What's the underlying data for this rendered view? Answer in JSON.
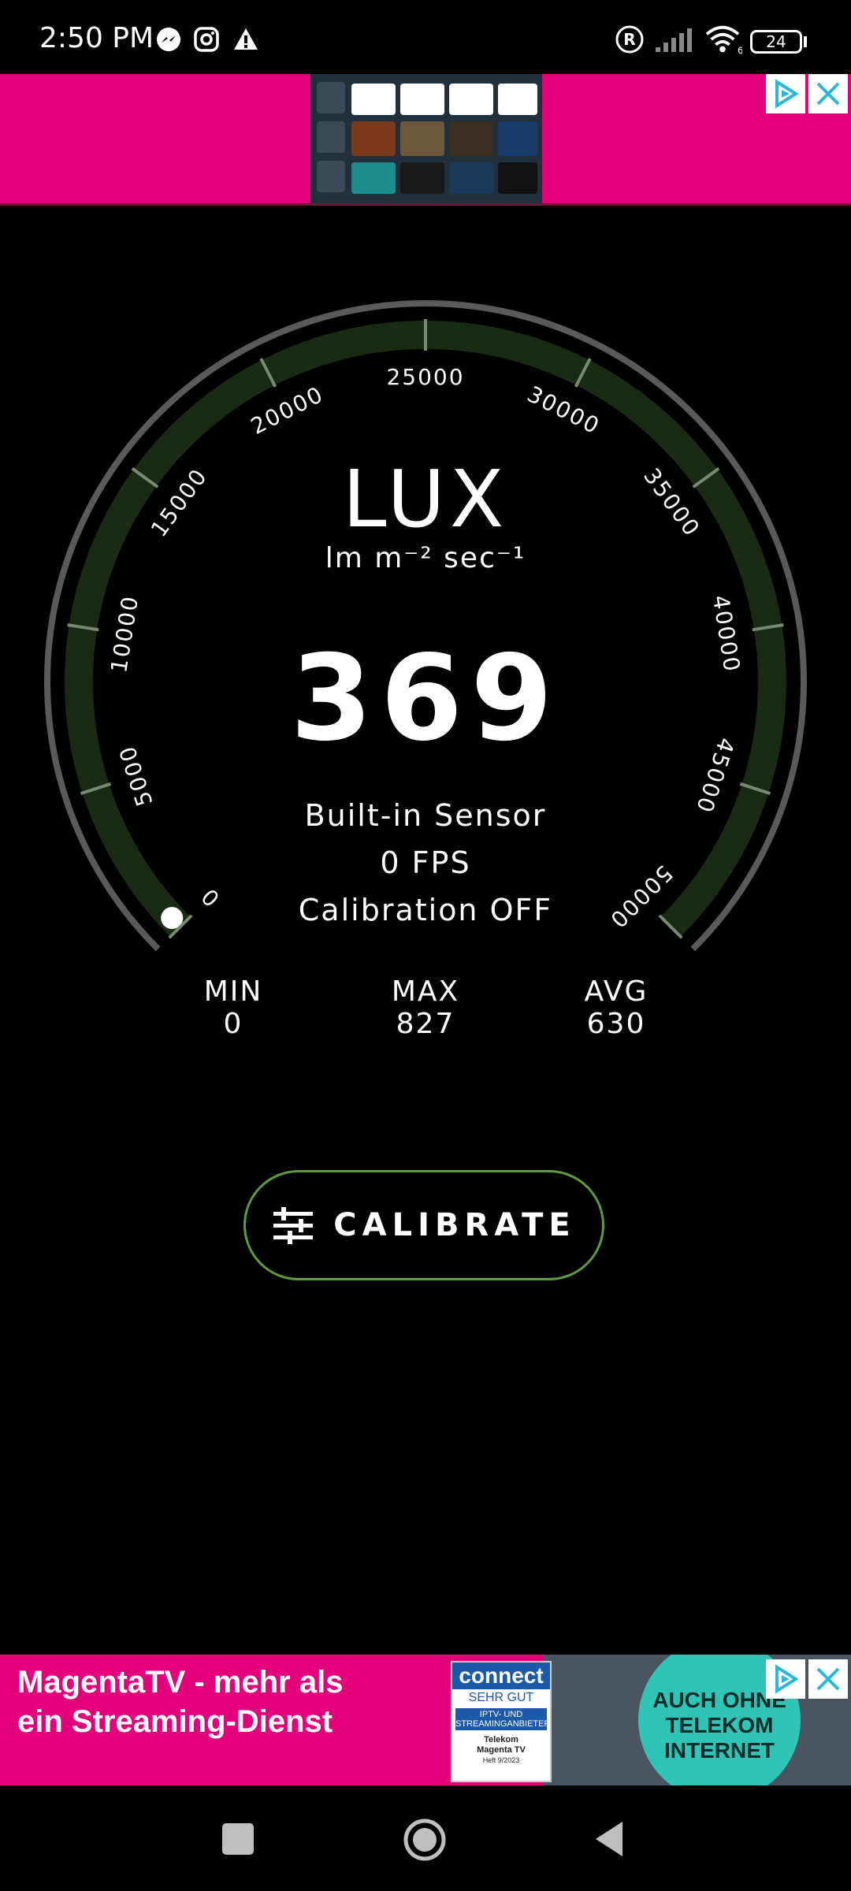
{
  "status_bar": {
    "time": "2:50 PM",
    "battery": "24",
    "icons": [
      "messenger-icon",
      "instagram-icon",
      "warning-icon",
      "registered-icon",
      "signal-icon",
      "wifi-icon",
      "battery-icon"
    ]
  },
  "ad_top": {
    "close_icon": "close-icon",
    "adchoices_icon": "adchoices-icon"
  },
  "gauge": {
    "title": "LUX",
    "unit": "lm m⁻² sec⁻¹",
    "value": "369",
    "source": "Built-in Sensor",
    "fps": "0 FPS",
    "calibration": "Calibration OFF",
    "scale_min": 0,
    "scale_max": 50000,
    "current_value": 369,
    "tick_labels": [
      "0",
      "5000",
      "10000",
      "15000",
      "20000",
      "25000",
      "30000",
      "35000",
      "40000",
      "45000",
      "50000"
    ],
    "colors": {
      "track": "#1a2b14",
      "outer": "#5a5a5a",
      "tick": "#7a8a70",
      "indicator": "#ffffff"
    }
  },
  "stats": [
    {
      "label": "MIN",
      "value": "0"
    },
    {
      "label": "MAX",
      "value": "827"
    },
    {
      "label": "AVG",
      "value": "630"
    }
  ],
  "calibrate": {
    "label": "CALIBRATE",
    "icon": "sliders-icon",
    "border_color": "#5f9a3c"
  },
  "ad_bottom": {
    "headline_1": "MagentaTV - mehr als",
    "headline_2": "ein Streaming-Dienst",
    "badge_title": "connect",
    "badge_rating": "SEHR GUT",
    "badge_line1": "IPTV- UND",
    "badge_line2": "STREAMINGANBIETER",
    "badge_brand1": "Telekom",
    "badge_brand2": "Magenta TV",
    "badge_issue": "Heft 9/2023",
    "circle_text_1": "AUCH OHNE",
    "circle_text_2": "TELEKOM",
    "circle_text_3": "INTERNET"
  },
  "nav": {
    "items": [
      "recents-button",
      "home-button",
      "back-button"
    ]
  }
}
